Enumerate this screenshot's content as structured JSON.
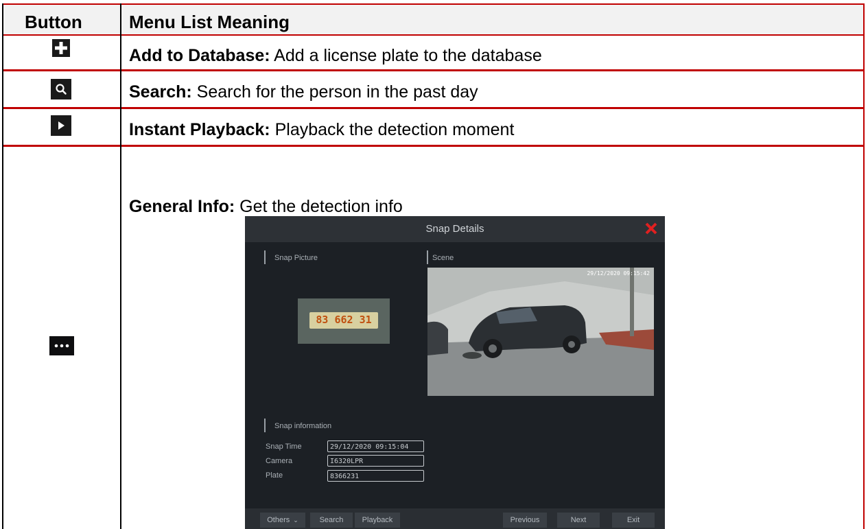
{
  "table": {
    "header": {
      "button": "Button",
      "meaning": "Menu List Meaning"
    },
    "rows": [
      {
        "icon": "plus-icon",
        "term": "Add to Database:",
        "desc": "Add a license plate to the database"
      },
      {
        "icon": "search-icon",
        "term": "Search:",
        "desc": "Search for the person in the past day"
      },
      {
        "icon": "play-icon",
        "term": "Instant Playback:",
        "desc": "Playback the detection moment"
      },
      {
        "icon": "more-dots-icon",
        "term": "General Info:",
        "desc": "Get the detection info"
      }
    ]
  },
  "dialog": {
    "title": "Snap Details",
    "snap_picture_label": "Snap Picture",
    "scene_label": "Scene",
    "plate_in_picture": "83 662 31",
    "scene_timestamp": "29/12/2020 09:15:42",
    "snap_info_label": "Snap information",
    "fields": [
      {
        "label": "Snap Time",
        "value": "29/12/2020 09:15:04"
      },
      {
        "label": "Camera",
        "value": "I6320LPR"
      },
      {
        "label": "Plate",
        "value": "8366231"
      }
    ],
    "buttons": {
      "others": "Others",
      "search": "Search",
      "playback": "Playback",
      "previous": "Previous",
      "next": "Next",
      "exit": "Exit"
    }
  },
  "colors": {
    "border_red": "#c00000",
    "header_bg": "#f2f2f2",
    "dialog_bg": "#1c2025",
    "close_red": "#e02020"
  }
}
